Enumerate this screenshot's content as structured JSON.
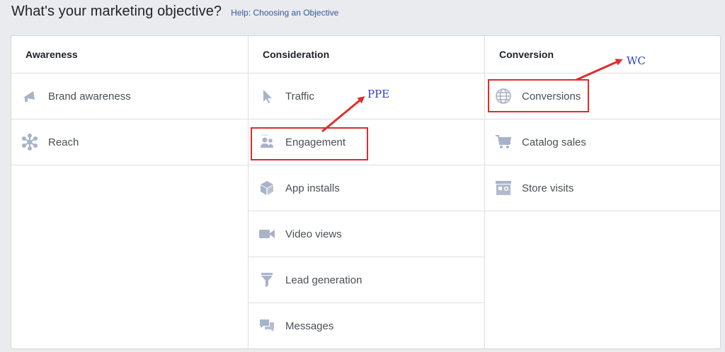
{
  "header": {
    "title": "What's your marketing objective?",
    "help_link": "Help: Choosing an Objective"
  },
  "columns": [
    {
      "heading": "Awareness",
      "items": [
        {
          "label": "Brand awareness",
          "icon": "megaphone-icon"
        },
        {
          "label": "Reach",
          "icon": "reach-icon"
        }
      ]
    },
    {
      "heading": "Consideration",
      "items": [
        {
          "label": "Traffic",
          "icon": "cursor-icon"
        },
        {
          "label": "Engagement",
          "icon": "people-icon"
        },
        {
          "label": "App installs",
          "icon": "box-icon"
        },
        {
          "label": "Video views",
          "icon": "video-camera-icon"
        },
        {
          "label": "Lead generation",
          "icon": "funnel-icon"
        },
        {
          "label": "Messages",
          "icon": "chat-bubbles-icon"
        }
      ]
    },
    {
      "heading": "Conversion",
      "items": [
        {
          "label": "Conversions",
          "icon": "globe-icon"
        },
        {
          "label": "Catalog sales",
          "icon": "cart-icon"
        },
        {
          "label": "Store visits",
          "icon": "store-icon"
        }
      ]
    }
  ],
  "annotations": {
    "ppe": "PPE",
    "wc": "WC"
  },
  "colors": {
    "icon": "#a8b3c9",
    "highlight": "#e02c2c",
    "annotation_text": "#2a3fd1",
    "link": "#365899"
  }
}
